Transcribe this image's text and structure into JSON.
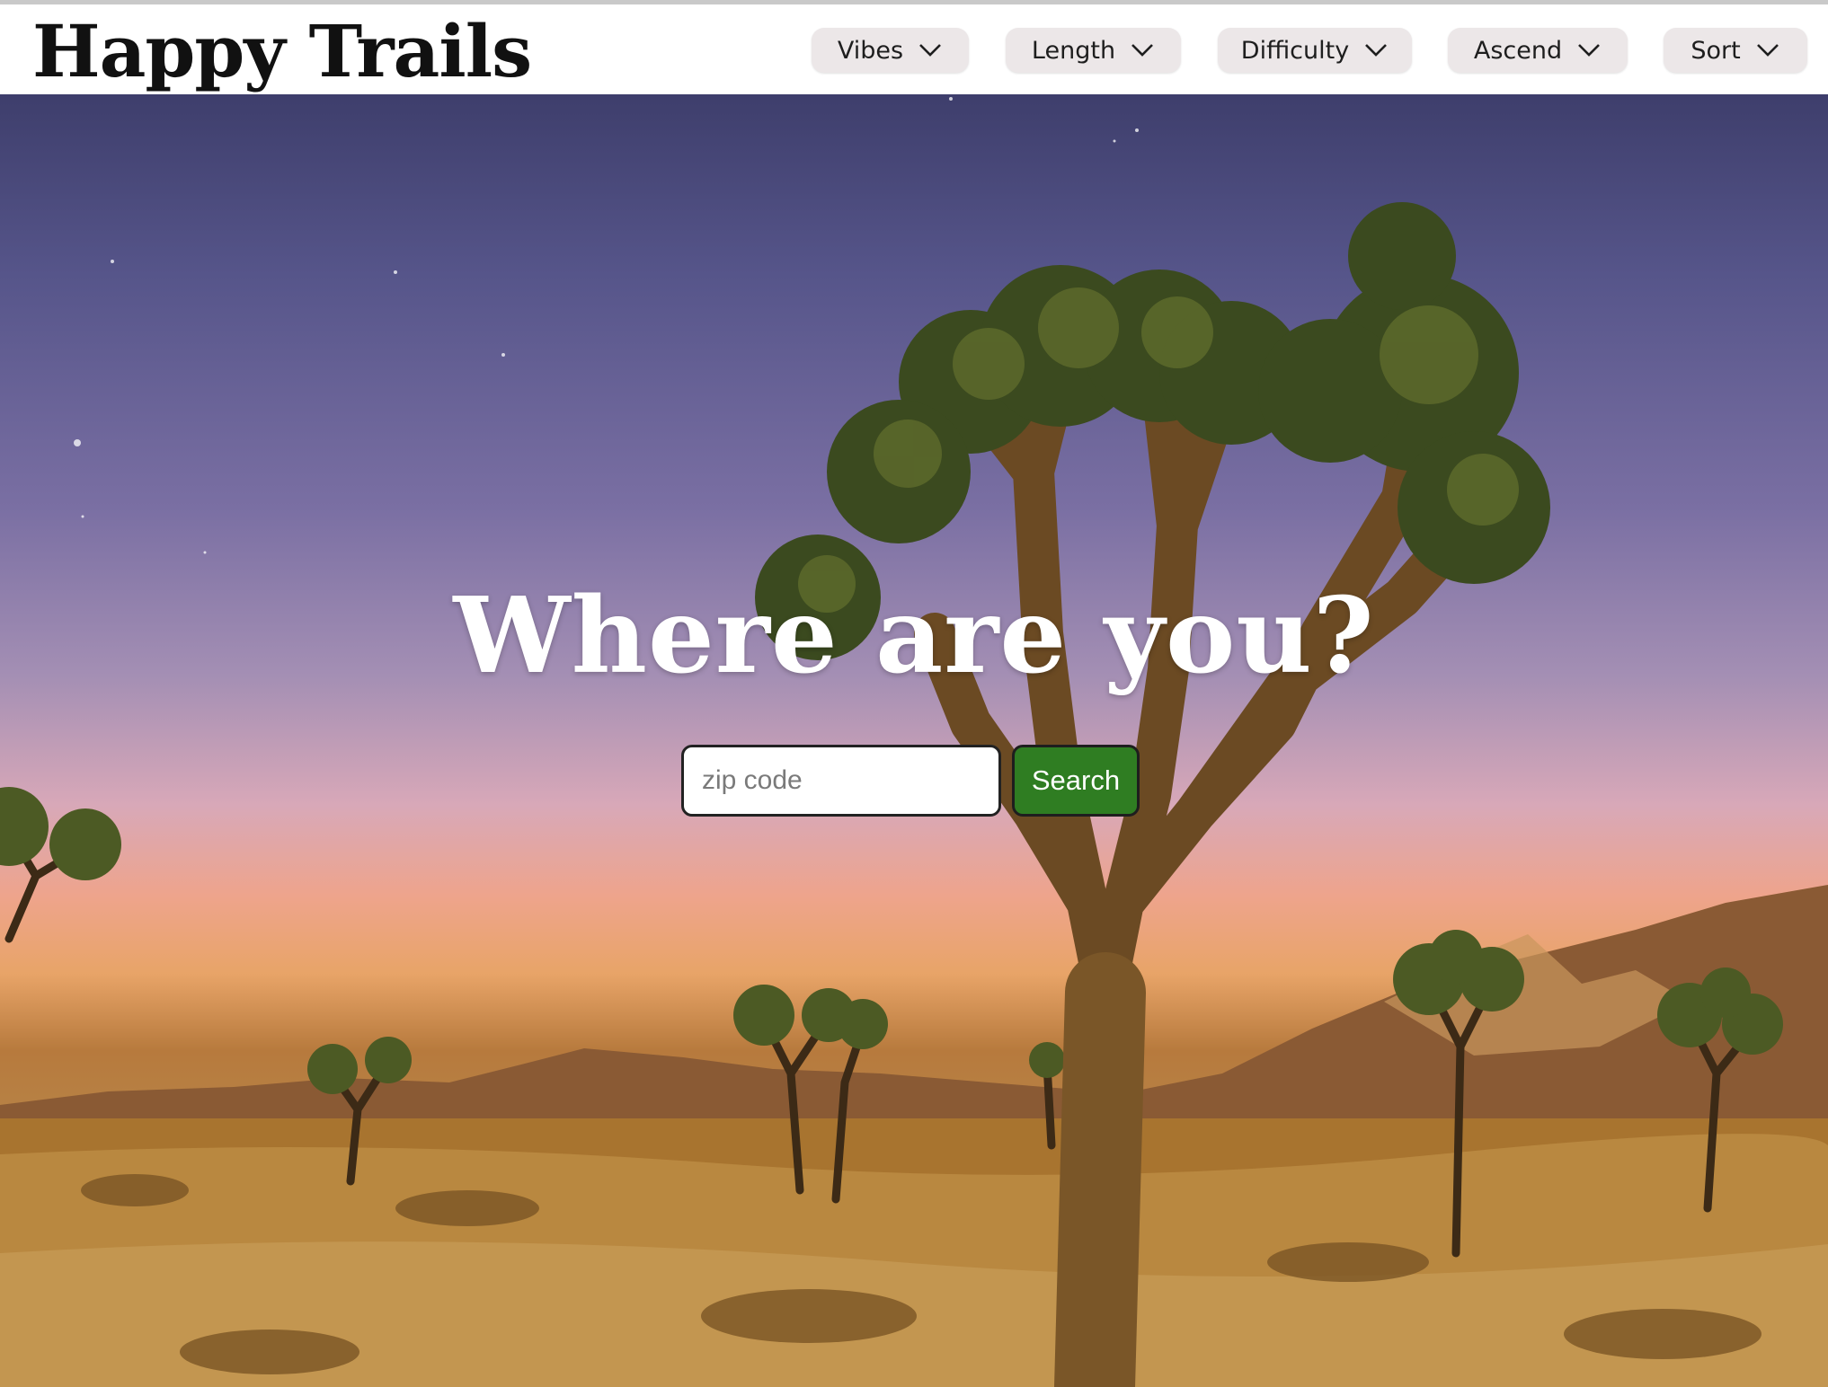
{
  "header": {
    "logo": "Happy Trails",
    "filters": [
      {
        "label": "Vibes"
      },
      {
        "label": "Length"
      },
      {
        "label": "Difficulty"
      },
      {
        "label": "Ascend"
      },
      {
        "label": "Sort"
      }
    ]
  },
  "hero": {
    "headline": "Where are you?",
    "search": {
      "value": "",
      "placeholder": "zip code",
      "button_label": "Search"
    },
    "background_image": "desert-joshua-tree-dusk-photo"
  },
  "colors": {
    "header_bg": "#ffffff",
    "filter_bg": "#ece7e8",
    "search_button": "#2f7d22",
    "headline_text": "#ffffff"
  },
  "icons": {
    "filter_chevron": "chevron-down-icon"
  }
}
